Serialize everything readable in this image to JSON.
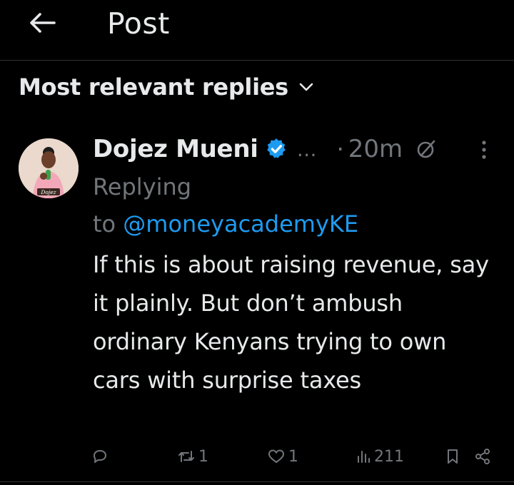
{
  "header": {
    "title": "Post",
    "back_icon": "arrow-left-icon"
  },
  "sort": {
    "label": "Most relevant replies",
    "icon": "chevron-down-icon"
  },
  "reply": {
    "author": {
      "display_name": "Dojez Mueni",
      "verified": true,
      "verified_color": "#1d9bf0",
      "avatar_caption": "Dojez"
    },
    "handle_truncation": "…",
    "separator": "·",
    "timestamp": "20m",
    "replying_prefix": "Replying",
    "replying_to_word": "to",
    "replying_to_handle": "@moneyacademyKE",
    "text": "If this is about raising revenue, say it plainly. But don’t ambush ordinary Kenyans trying to own cars with surprise taxes",
    "actions": {
      "reply_count": "",
      "retweet_count": "1",
      "like_count": "1",
      "view_count": "211"
    }
  },
  "colors": {
    "background": "#000000",
    "primary_text": "#e7e9ea",
    "secondary_text": "#71767b",
    "link": "#1d9bf0",
    "divider": "#2f3336"
  }
}
